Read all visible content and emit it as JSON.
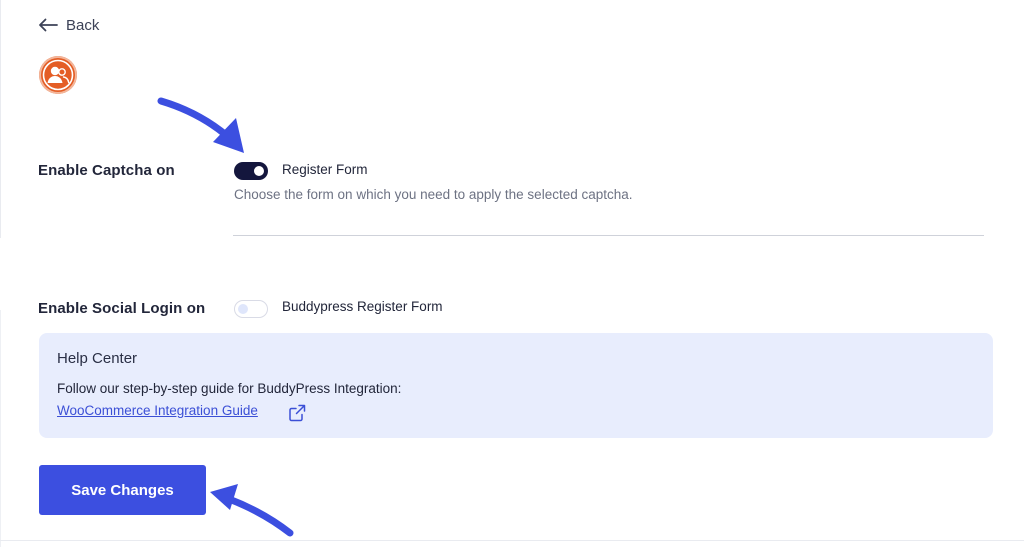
{
  "nav": {
    "back_label": "Back"
  },
  "captcha": {
    "label": "Enable Captcha on",
    "option_label": "Register Form",
    "option_enabled": true,
    "helper": "Choose the form on which you need to apply the selected captcha."
  },
  "social": {
    "label": "Enable Social Login on",
    "option_label": "Buddypress Register Form",
    "option_enabled": false
  },
  "help": {
    "title": "Help Center",
    "text": "Follow our step-by-step guide for BuddyPress Integration:",
    "link_text": "WooCommerce Integration Guide"
  },
  "actions": {
    "save_label": "Save Changes"
  },
  "icons": {
    "back": "arrow-left-icon",
    "logo": "user-group-icon",
    "external": "external-link-icon",
    "annotation": "annotation-arrow-icon"
  },
  "colors": {
    "accent": "#3c4fe0",
    "toggle_on": "#14163d",
    "help_bg": "#e8edfd",
    "logo": "#e45d25"
  }
}
